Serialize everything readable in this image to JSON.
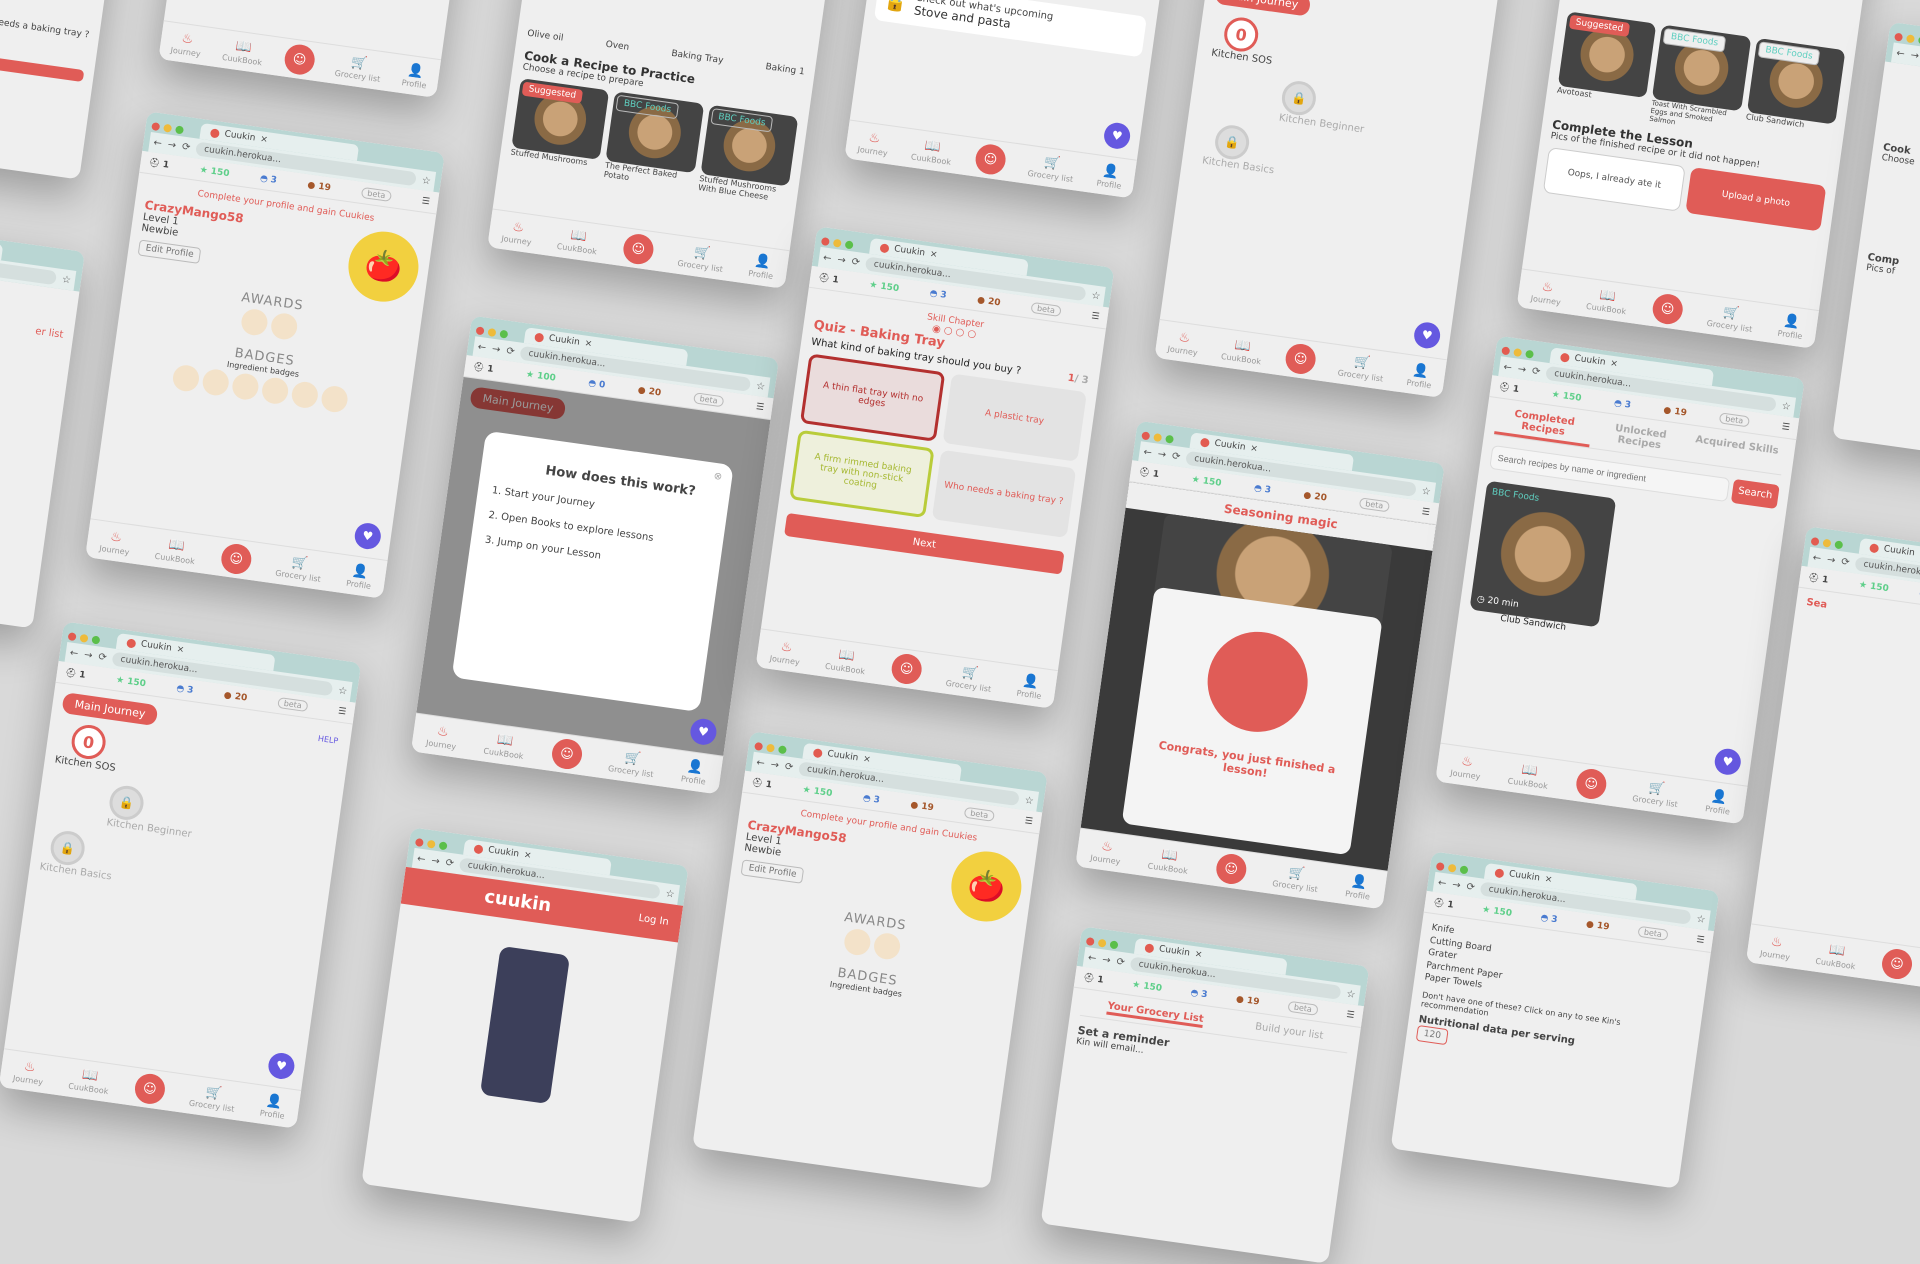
{
  "browser": {
    "tab": "Cuukin",
    "url": "cuukin.herokua...",
    "back": "←",
    "forward": "→",
    "reload": "⟳"
  },
  "nav": {
    "journey": "Journey",
    "cuukbook": "CuukBook",
    "grocery": "Grocery list",
    "profile": "Profile"
  },
  "common": {
    "beta": "beta",
    "help": "HELP"
  },
  "stats": {
    "profile": {
      "chef": "1",
      "stars": "150",
      "cloche": "3",
      "cookies": "19"
    },
    "quiz": {
      "chef": "1",
      "stars": "150",
      "cloche": "3",
      "cookies": "20"
    },
    "how": {
      "chef": "1",
      "stars": "100",
      "cloche": "0",
      "cookies": "20"
    },
    "journey": {
      "chef": "1",
      "stars": "150",
      "cloche": "3",
      "cookies": "20"
    },
    "seasoning": {
      "chef": "1",
      "stars": "150",
      "cloche": "3",
      "cookies": "20"
    },
    "recipes": {
      "chef": "1",
      "stars": "150",
      "cloche": "3",
      "cookies": "19"
    },
    "grocery": {
      "chef": "1",
      "stars": "150",
      "cloche": "3",
      "cookies": "19"
    },
    "tools": {
      "chef": "1",
      "stars": "150",
      "cloche": "3",
      "cookies": "19"
    }
  },
  "profile": {
    "banner": "Complete your profile and gain Cuukies",
    "username": "CrazyMango58",
    "level": "Level 1",
    "rank": "Newbie",
    "edit": "Edit Profile",
    "awards": "AWARDS",
    "badges": "BADGES",
    "badges_sub": "Ingredient badges"
  },
  "how": {
    "title": "How does this work?",
    "step1": "1. Start your Journey",
    "step2": "2. Open Books to explore lessons",
    "step3": "3. Jump on your Lesson",
    "bg_button": "Main Journey"
  },
  "quiz": {
    "chapter": "Skill Chapter",
    "title": "Quiz - Baking Tray",
    "question": "What kind of baking tray should you buy ?",
    "progress_current": "1",
    "progress_total": "/ 3",
    "options": [
      "A thin flat tray with no edges",
      "A plastic tray",
      "A firm rimmed baking tray with non-stick coating",
      "Who needs a baking tray ?"
    ],
    "next": "Next"
  },
  "journey": {
    "button": "Main Journey",
    "score": "0",
    "nodes": [
      "Kitchen SOS",
      "Kitchen Beginner",
      "Kitchen Basics"
    ]
  },
  "landing": {
    "logo": "cuukin",
    "login": "Log In"
  },
  "seasoning": {
    "title": "Seasoning magic",
    "congrats": "Congrats, you just finished a lesson!"
  },
  "grocery": {
    "tab1": "Your Grocery List",
    "tab2": "Build your list",
    "reminder": "Set a reminder",
    "reminder_sub": "Kin will email..."
  },
  "recipes": {
    "tabs": [
      "Completed Recipes",
      "Unlocked Recipes",
      "Acquired Skills"
    ],
    "search_placeholder": "Search recipes by name or ingredient",
    "search": "Search",
    "source": "BBC Foods",
    "time": "20 min",
    "name": "Club Sandwich"
  },
  "tools": {
    "items": [
      "Knife",
      "Cutting Board",
      "Grater",
      "Parchment Paper",
      "Paper Towels"
    ],
    "hint": "Don't have one of these? Click on any to see Kin's recommendation",
    "nutrition": "Nutritional data per serving",
    "value": "120"
  },
  "practice": {
    "ingredients": [
      "Olive oil",
      "Oven",
      "Baking Tray",
      "Baking 1"
    ],
    "title": "Cook a Recipe to Practice",
    "subtitle": "Choose a recipe to prepare",
    "tags": [
      "Suggested",
      "BBC Foods",
      "BBC Foods"
    ],
    "recipes": [
      "Stuffed Mushrooms",
      "The Perfect Baked Potato",
      "Stuffed Mushrooms With Blue Cheese"
    ]
  },
  "upcoming": {
    "line1": "Check out what's upcoming",
    "line2": "Stove and pasta"
  },
  "lesson": {
    "tag1": "Suggested",
    "tag2": "BBC Foods",
    "tag3": "BBC Foods",
    "recipes": [
      "Avotoast",
      "Toast With Scrambled Eggs and Smoked Salmon",
      "Club Sandwich"
    ],
    "title": "Complete the Lesson",
    "subtitle": "Pics of the finished recipe or it did not happen!",
    "oops": "Oops, I already ate it",
    "upload": "Upload a photo"
  },
  "edge": {
    "left_top": "needs a baking tray ?",
    "left_mid": "er list",
    "right_top": "Cook",
    "right_mid": "Choose",
    "right_sea": "Sea",
    "right_comp": "Comp",
    "right_pics": "Pics of"
  }
}
